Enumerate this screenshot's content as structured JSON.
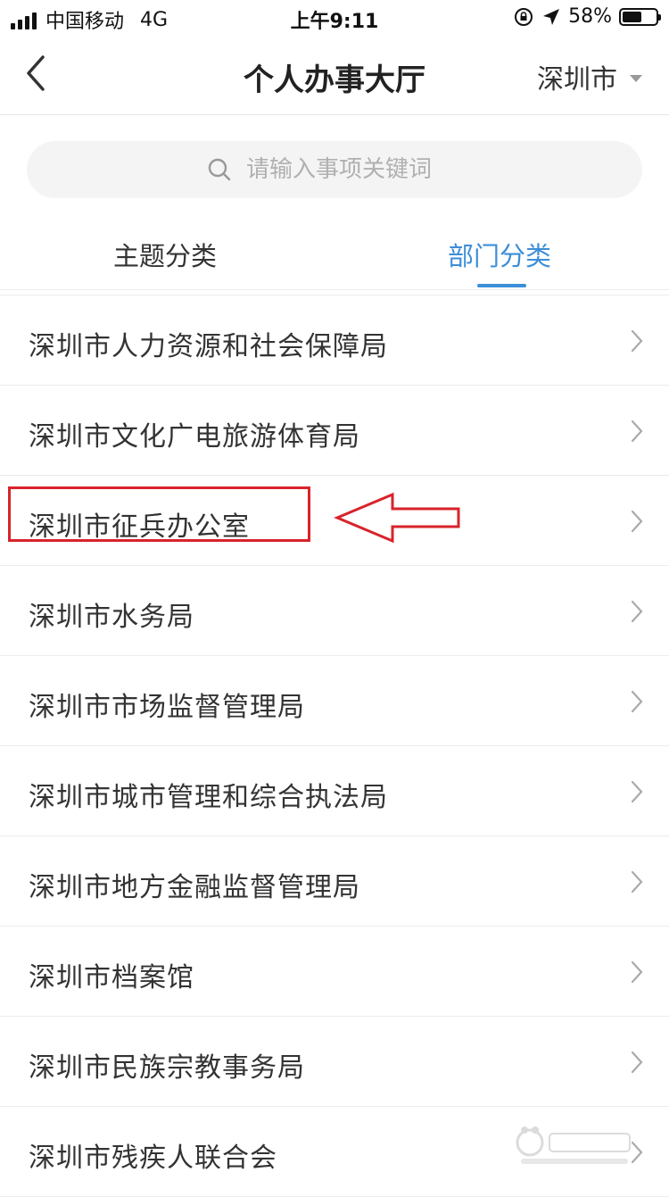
{
  "status_bar": {
    "carrier": "中国移动",
    "network": "4G",
    "time": "上午9:11",
    "battery_text": "58%",
    "battery_level": 0.58
  },
  "nav": {
    "title": "个人办事大厅",
    "city": "深圳市"
  },
  "search": {
    "placeholder": "请输入事项关键词"
  },
  "tabs": [
    {
      "label": "主题分类",
      "active": false
    },
    {
      "label": "部门分类",
      "active": true
    }
  ],
  "departments": [
    "深圳市人力资源和社会保障局",
    "深圳市文化广电旅游体育局",
    "深圳市征兵办公室",
    "深圳市水务局",
    "深圳市市场监督管理局",
    "深圳市城市管理和综合执法局",
    "深圳市地方金融监督管理局",
    "深圳市档案馆",
    "深圳市民族宗教事务局",
    "深圳市残疾人联合会"
  ],
  "colors": {
    "accent": "#3c8ed8",
    "annotation": "#d9232b"
  },
  "icons": [
    "back-arrow-icon",
    "caret-down-icon",
    "search-icon",
    "chevron-right-icon",
    "location-arrow-icon",
    "rotation-lock-icon"
  ]
}
